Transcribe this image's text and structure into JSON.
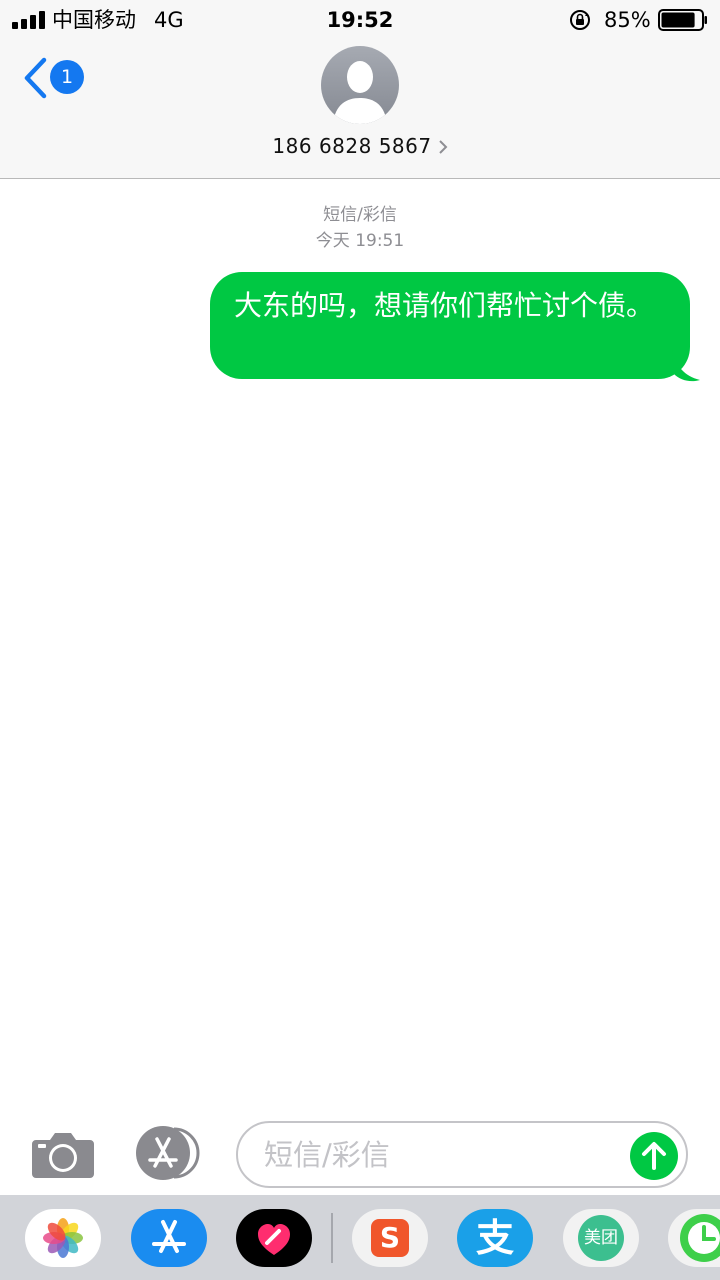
{
  "status_bar": {
    "carrier": "中国移动",
    "network": "4G",
    "time": "19:52",
    "battery_percent": "85%",
    "battery_level": 0.85
  },
  "header": {
    "back_badge_count": "1",
    "contact_number": "186 6828 5867"
  },
  "conversation": {
    "message_type": "短信/彩信",
    "timestamp": "今天 19:51",
    "messages": [
      {
        "direction": "outgoing",
        "text": "大东的吗，想请你们帮忙讨个债。"
      }
    ]
  },
  "input": {
    "placeholder": "短信/彩信"
  },
  "app_drawer": {
    "apps": [
      {
        "icon": "photos-icon"
      },
      {
        "icon": "app-store-icon"
      },
      {
        "icon": "digital-touch-icon"
      },
      {
        "icon": "sogou-icon",
        "label": "S"
      },
      {
        "icon": "alipay-icon",
        "label": "支"
      },
      {
        "icon": "meituan-icon",
        "label": "美团"
      },
      {
        "icon": "clock-app-icon"
      }
    ]
  },
  "colors": {
    "bubble_green": "#00c843",
    "ios_blue": "#1478f0",
    "meta_gray": "#8e8e93"
  }
}
